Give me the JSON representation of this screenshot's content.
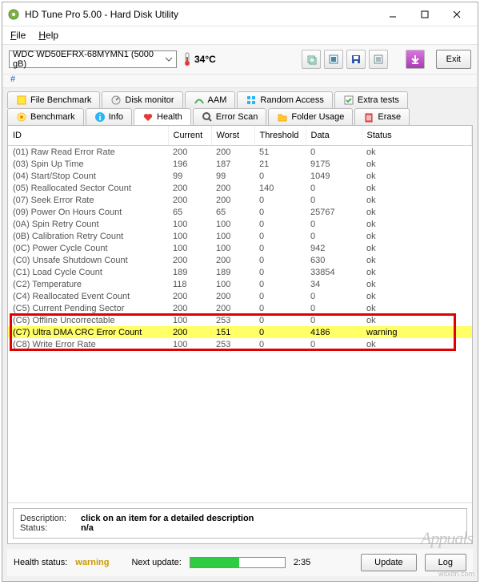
{
  "window": {
    "title": "HD Tune Pro 5.00 - Hard Disk Utility"
  },
  "menu": {
    "file": "File",
    "help": "Help"
  },
  "toolbar": {
    "drive": "WDC WD50EFRX-68MYMN1 (5000 gB)",
    "temp": "34°C",
    "exit": "Exit",
    "hash": "#"
  },
  "tabs_row1": [
    {
      "label": "File Benchmark"
    },
    {
      "label": "Disk monitor"
    },
    {
      "label": "AAM"
    },
    {
      "label": "Random Access"
    },
    {
      "label": "Extra tests"
    }
  ],
  "tabs_row2": [
    {
      "label": "Benchmark"
    },
    {
      "label": "Info"
    },
    {
      "label": "Health"
    },
    {
      "label": "Error Scan"
    },
    {
      "label": "Folder Usage"
    },
    {
      "label": "Erase"
    }
  ],
  "columns": {
    "id": "ID",
    "current": "Current",
    "worst": "Worst",
    "threshold": "Threshold",
    "data": "Data",
    "status": "Status"
  },
  "rows": [
    {
      "id": "(01) Raw Read Error Rate",
      "current": "200",
      "worst": "200",
      "threshold": "51",
      "data": "0",
      "status": "ok"
    },
    {
      "id": "(03) Spin Up Time",
      "current": "196",
      "worst": "187",
      "threshold": "21",
      "data": "9175",
      "status": "ok"
    },
    {
      "id": "(04) Start/Stop Count",
      "current": "99",
      "worst": "99",
      "threshold": "0",
      "data": "1049",
      "status": "ok"
    },
    {
      "id": "(05) Reallocated Sector Count",
      "current": "200",
      "worst": "200",
      "threshold": "140",
      "data": "0",
      "status": "ok"
    },
    {
      "id": "(07) Seek Error Rate",
      "current": "200",
      "worst": "200",
      "threshold": "0",
      "data": "0",
      "status": "ok"
    },
    {
      "id": "(09) Power On Hours Count",
      "current": "65",
      "worst": "65",
      "threshold": "0",
      "data": "25767",
      "status": "ok"
    },
    {
      "id": "(0A) Spin Retry Count",
      "current": "100",
      "worst": "100",
      "threshold": "0",
      "data": "0",
      "status": "ok"
    },
    {
      "id": "(0B) Calibration Retry Count",
      "current": "100",
      "worst": "100",
      "threshold": "0",
      "data": "0",
      "status": "ok"
    },
    {
      "id": "(0C) Power Cycle Count",
      "current": "100",
      "worst": "100",
      "threshold": "0",
      "data": "942",
      "status": "ok"
    },
    {
      "id": "(C0) Unsafe Shutdown Count",
      "current": "200",
      "worst": "200",
      "threshold": "0",
      "data": "630",
      "status": "ok"
    },
    {
      "id": "(C1) Load Cycle Count",
      "current": "189",
      "worst": "189",
      "threshold": "0",
      "data": "33854",
      "status": "ok"
    },
    {
      "id": "(C2) Temperature",
      "current": "118",
      "worst": "100",
      "threshold": "0",
      "data": "34",
      "status": "ok"
    },
    {
      "id": "(C4) Reallocated Event Count",
      "current": "200",
      "worst": "200",
      "threshold": "0",
      "data": "0",
      "status": "ok"
    },
    {
      "id": "(C5) Current Pending Sector",
      "current": "200",
      "worst": "200",
      "threshold": "0",
      "data": "0",
      "status": "ok"
    },
    {
      "id": "(C6) Offline Uncorrectable",
      "current": "100",
      "worst": "253",
      "threshold": "0",
      "data": "0",
      "status": "ok"
    },
    {
      "id": "(C7) Ultra DMA CRC Error Count",
      "current": "200",
      "worst": "151",
      "threshold": "0",
      "data": "4186",
      "status": "warning",
      "hl": true
    },
    {
      "id": "(C8) Write Error Rate",
      "current": "100",
      "worst": "253",
      "threshold": "0",
      "data": "0",
      "status": "ok"
    }
  ],
  "desc": {
    "label_desc": "Description:",
    "label_status": "Status:",
    "desc_val": "click on an item for a detailed description",
    "status_val": "n/a"
  },
  "footer": {
    "health_label": "Health status:",
    "health_value": "warning",
    "next_update": "Next update:",
    "time_left": "2:35",
    "update_btn": "Update",
    "log_btn": "Log",
    "progress_pct": 52
  },
  "watermark": "Appuals"
}
